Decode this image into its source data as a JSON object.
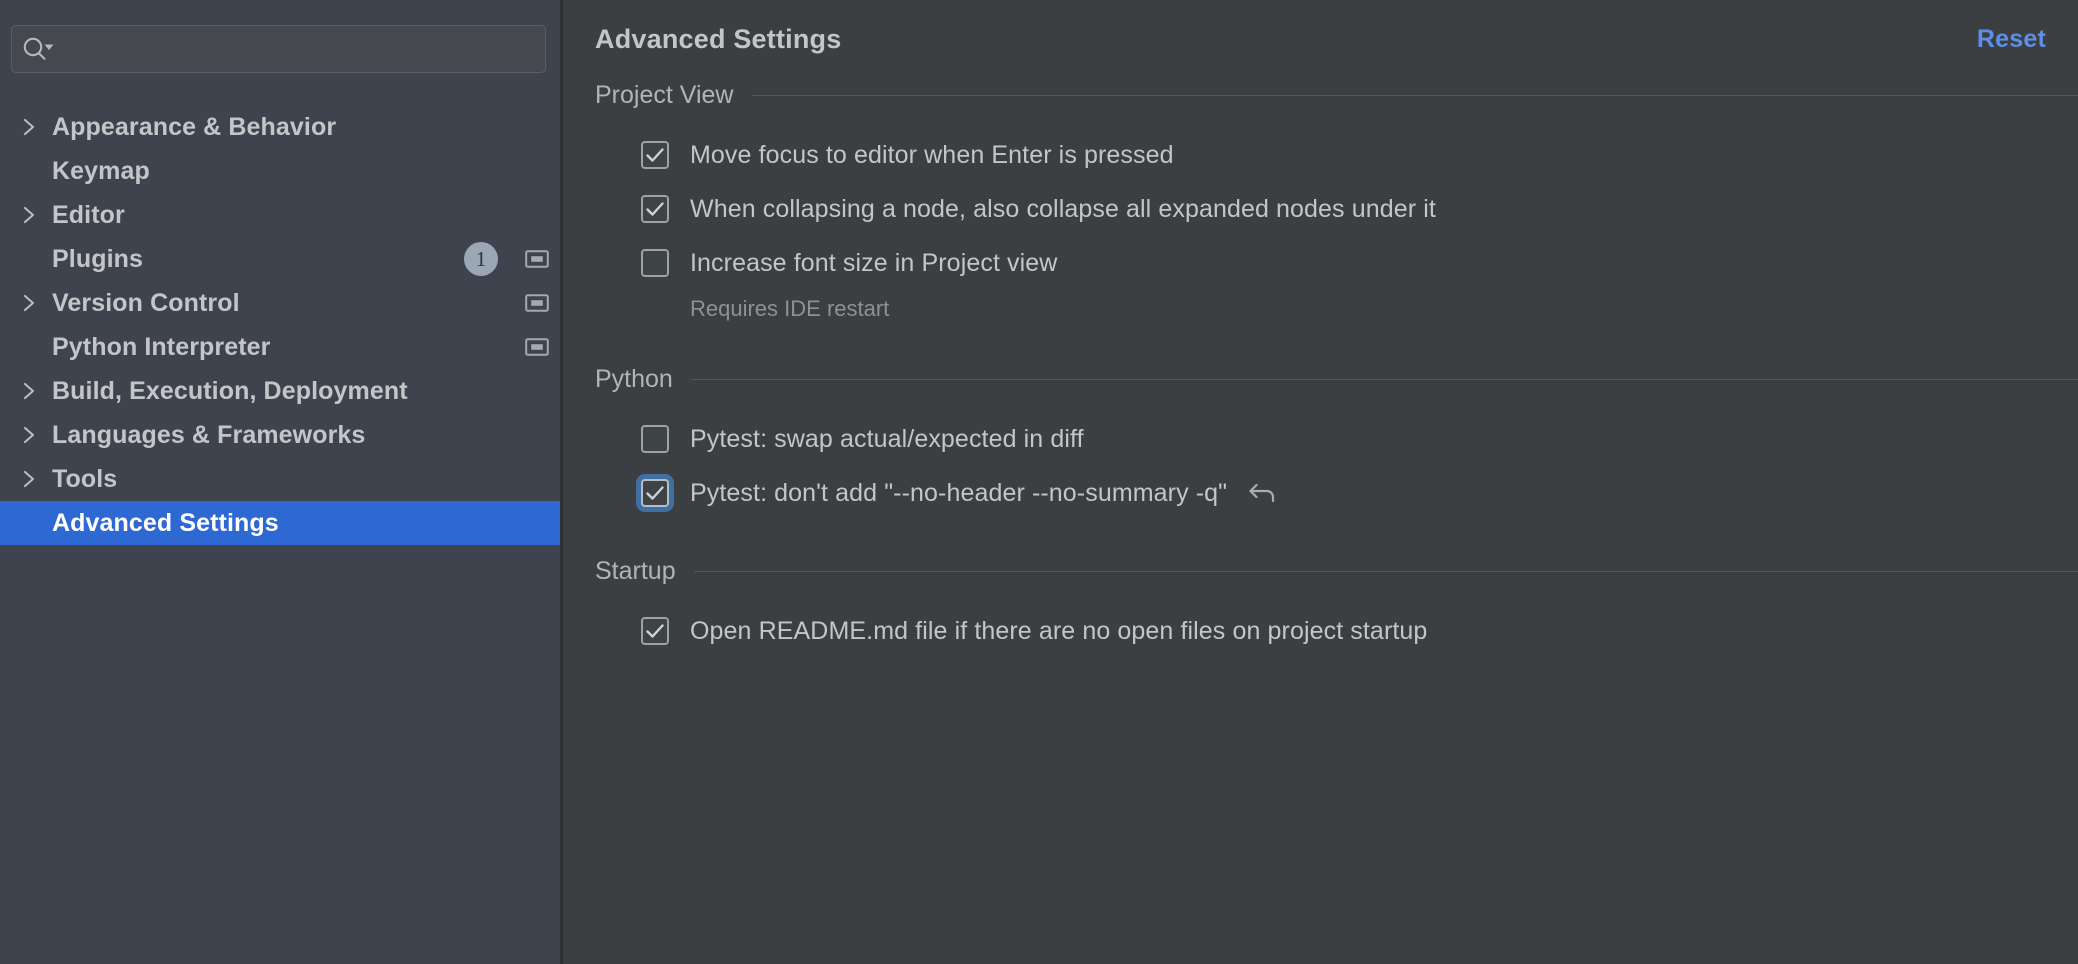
{
  "colors": {
    "sidebar_bg": "#3f434d",
    "main_bg": "#3c3f41",
    "selection_blue": "#2e68d3",
    "link_blue": "#5b8fe8",
    "focus_ring_blue": "#3f6fa3",
    "text_primary": "#c3c6c9",
    "text_muted": "#8d9194",
    "rule": "#53575a"
  },
  "sidebar": {
    "search": {
      "value": "",
      "placeholder": "",
      "icon": "search-icon",
      "dropdown_icon": "chevron-down-icon"
    },
    "items": [
      {
        "label": "Appearance & Behavior",
        "expandable": true,
        "selected": false,
        "badge": null,
        "scope_icon": false
      },
      {
        "label": "Keymap",
        "expandable": false,
        "selected": false,
        "badge": null,
        "scope_icon": false
      },
      {
        "label": "Editor",
        "expandable": true,
        "selected": false,
        "badge": null,
        "scope_icon": false
      },
      {
        "label": "Plugins",
        "expandable": false,
        "selected": false,
        "badge": "1",
        "scope_icon": true
      },
      {
        "label": "Version Control",
        "expandable": true,
        "selected": false,
        "badge": null,
        "scope_icon": true
      },
      {
        "label": "Python Interpreter",
        "expandable": false,
        "selected": false,
        "badge": null,
        "scope_icon": true
      },
      {
        "label": "Build, Execution, Deployment",
        "expandable": true,
        "selected": false,
        "badge": null,
        "scope_icon": false
      },
      {
        "label": "Languages & Frameworks",
        "expandable": true,
        "selected": false,
        "badge": null,
        "scope_icon": false
      },
      {
        "label": "Tools",
        "expandable": true,
        "selected": false,
        "badge": null,
        "scope_icon": false
      },
      {
        "label": "Advanced Settings",
        "expandable": false,
        "selected": true,
        "badge": null,
        "scope_icon": false
      }
    ]
  },
  "main": {
    "title": "Advanced Settings",
    "reset_label": "Reset",
    "sections": [
      {
        "title": "Project View",
        "options": [
          {
            "label": "Move focus to editor when Enter is pressed",
            "checked": true,
            "focused": false,
            "hint": null,
            "revert": false
          },
          {
            "label": "When collapsing a node, also collapse all expanded nodes under it",
            "checked": true,
            "focused": false,
            "hint": null,
            "revert": false
          },
          {
            "label": "Increase font size in Project view",
            "checked": false,
            "focused": false,
            "hint": "Requires IDE restart",
            "revert": false
          }
        ]
      },
      {
        "title": "Python",
        "options": [
          {
            "label": "Pytest: swap actual/expected in diff",
            "checked": false,
            "focused": false,
            "hint": null,
            "revert": false
          },
          {
            "label": "Pytest: don't add \"--no-header --no-summary -q\"",
            "checked": true,
            "focused": true,
            "hint": null,
            "revert": true
          }
        ]
      },
      {
        "title": "Startup",
        "options": [
          {
            "label": "Open README.md file if there are no open files on project startup",
            "checked": true,
            "focused": false,
            "hint": null,
            "revert": false
          }
        ]
      }
    ]
  }
}
